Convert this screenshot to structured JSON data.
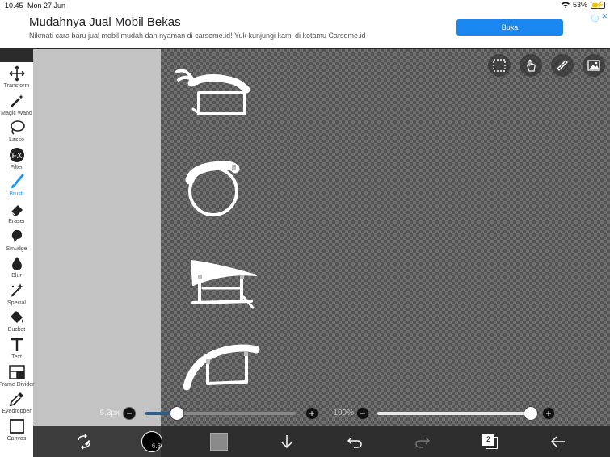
{
  "status": {
    "time": "10.45",
    "date": "Mon 27 Jun",
    "battery": "53%",
    "battery_level": 0.53
  },
  "ad": {
    "title": "Mudahnya Jual Mobil Bekas",
    "subtitle": "Nikmati cara baru jual mobil mudah dan nyaman di carsome.id! Yuk kunjungi kami di kotamu Carsome.id",
    "button": "Buka"
  },
  "tools": [
    {
      "label": "Transform",
      "icon": "transform-icon"
    },
    {
      "label": "Magic Wand",
      "icon": "magic-wand-icon"
    },
    {
      "label": "Lasso",
      "icon": "lasso-icon"
    },
    {
      "label": "Filter",
      "icon": "filter-icon"
    },
    {
      "label": "Brush",
      "icon": "brush-icon"
    },
    {
      "label": "Eraser",
      "icon": "eraser-icon"
    },
    {
      "label": "Smudge",
      "icon": "smudge-icon"
    },
    {
      "label": "Blur",
      "icon": "blur-icon"
    },
    {
      "label": "Special",
      "icon": "special-icon"
    },
    {
      "label": "Bucket",
      "icon": "bucket-icon"
    },
    {
      "label": "Text",
      "icon": "text-icon"
    },
    {
      "label": "Frame Divider",
      "icon": "frame-divider-icon"
    },
    {
      "label": "Eyedropper",
      "icon": "eyedropper-icon"
    },
    {
      "label": "Canvas",
      "icon": "canvas-icon"
    }
  ],
  "active_tool": "Brush",
  "brush": {
    "size_label": "6.3px",
    "size_fraction": 0.21,
    "color_label": "6.3"
  },
  "opacity": {
    "label": "100%",
    "fraction": 1.0
  },
  "layers": {
    "count": "2"
  },
  "colors": {
    "accent": "#2196f3",
    "brush_track": "#2f5d8c"
  }
}
